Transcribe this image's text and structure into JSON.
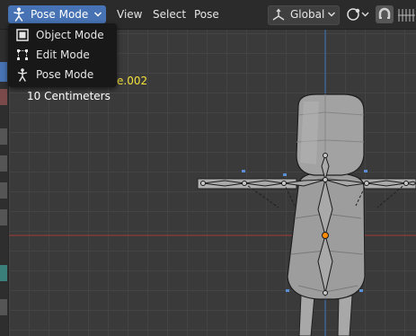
{
  "header": {
    "mode_selector": {
      "selected": "Pose Mode",
      "icon": "pose-mode-icon"
    },
    "menus": [
      "View",
      "Select",
      "Pose"
    ],
    "transform_orientation": {
      "value": "Global",
      "icon": "orientation-axes-icon"
    },
    "pivot_icon": "pivot-point-icon",
    "snap_icon": "snap-magnet-icon",
    "mirror_icon": "mirror-xyz-icon"
  },
  "mode_menu": {
    "items": [
      {
        "label": "Object Mode",
        "icon": "object-mode-icon"
      },
      {
        "label": "Edit Mode",
        "icon": "edit-mode-icon"
      },
      {
        "label": "Pose Mode",
        "icon": "pose-mode-icon"
      }
    ]
  },
  "viewport": {
    "active_object_name_partial": "e.002",
    "grid_scale": "10 Centimeters"
  },
  "colors": {
    "accent_blue": "#4772b3",
    "active_name_yellow": "#f4e23b",
    "selected_joint_orange": "#ff8c00",
    "x_axis_red": "#a33a3a",
    "z_axis_blue": "#3a73b8"
  }
}
